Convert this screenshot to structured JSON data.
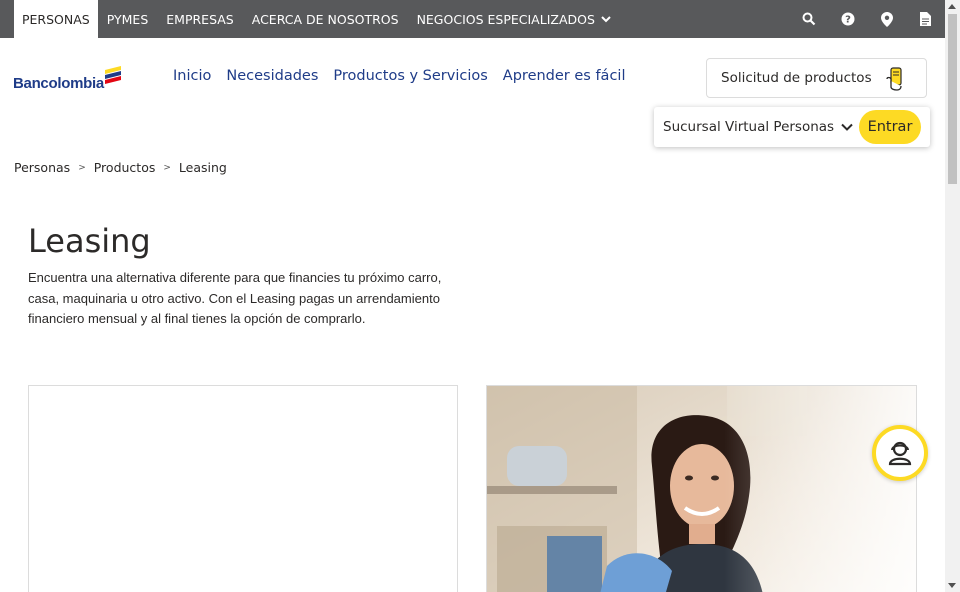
{
  "topbar": {
    "tabs": [
      "PERSONAS",
      "PYMES",
      "EMPRESAS",
      "ACERCA DE NOSOTROS",
      "NEGOCIOS ESPECIALIZADOS"
    ],
    "icons": [
      "search-icon",
      "help-icon",
      "location-icon",
      "document-icon"
    ]
  },
  "header": {
    "logo_text": "Bancolombia",
    "nav": [
      "Inicio",
      "Necesidades",
      "Productos y Servicios",
      "Aprender es fácil"
    ],
    "solicitud_label": "Solicitud de productos",
    "sucursal_label": "Sucursal Virtual Personas",
    "entrar_label": "Entrar"
  },
  "breadcrumb": [
    "Personas",
    "Productos",
    "Leasing"
  ],
  "breadcrumb_sep": ">",
  "main": {
    "title": "Leasing",
    "description": "Encuentra una alternativa diferente para que financies tu próximo carro, casa, maquinaria u otro activo. Con el Leasing pagas un arrendamiento financiero mensual y al final tienes la opción de comprarlo."
  },
  "colors": {
    "topbar": "#58595b",
    "brand_blue": "#1f3c88",
    "accent_yellow": "#fdda24"
  }
}
